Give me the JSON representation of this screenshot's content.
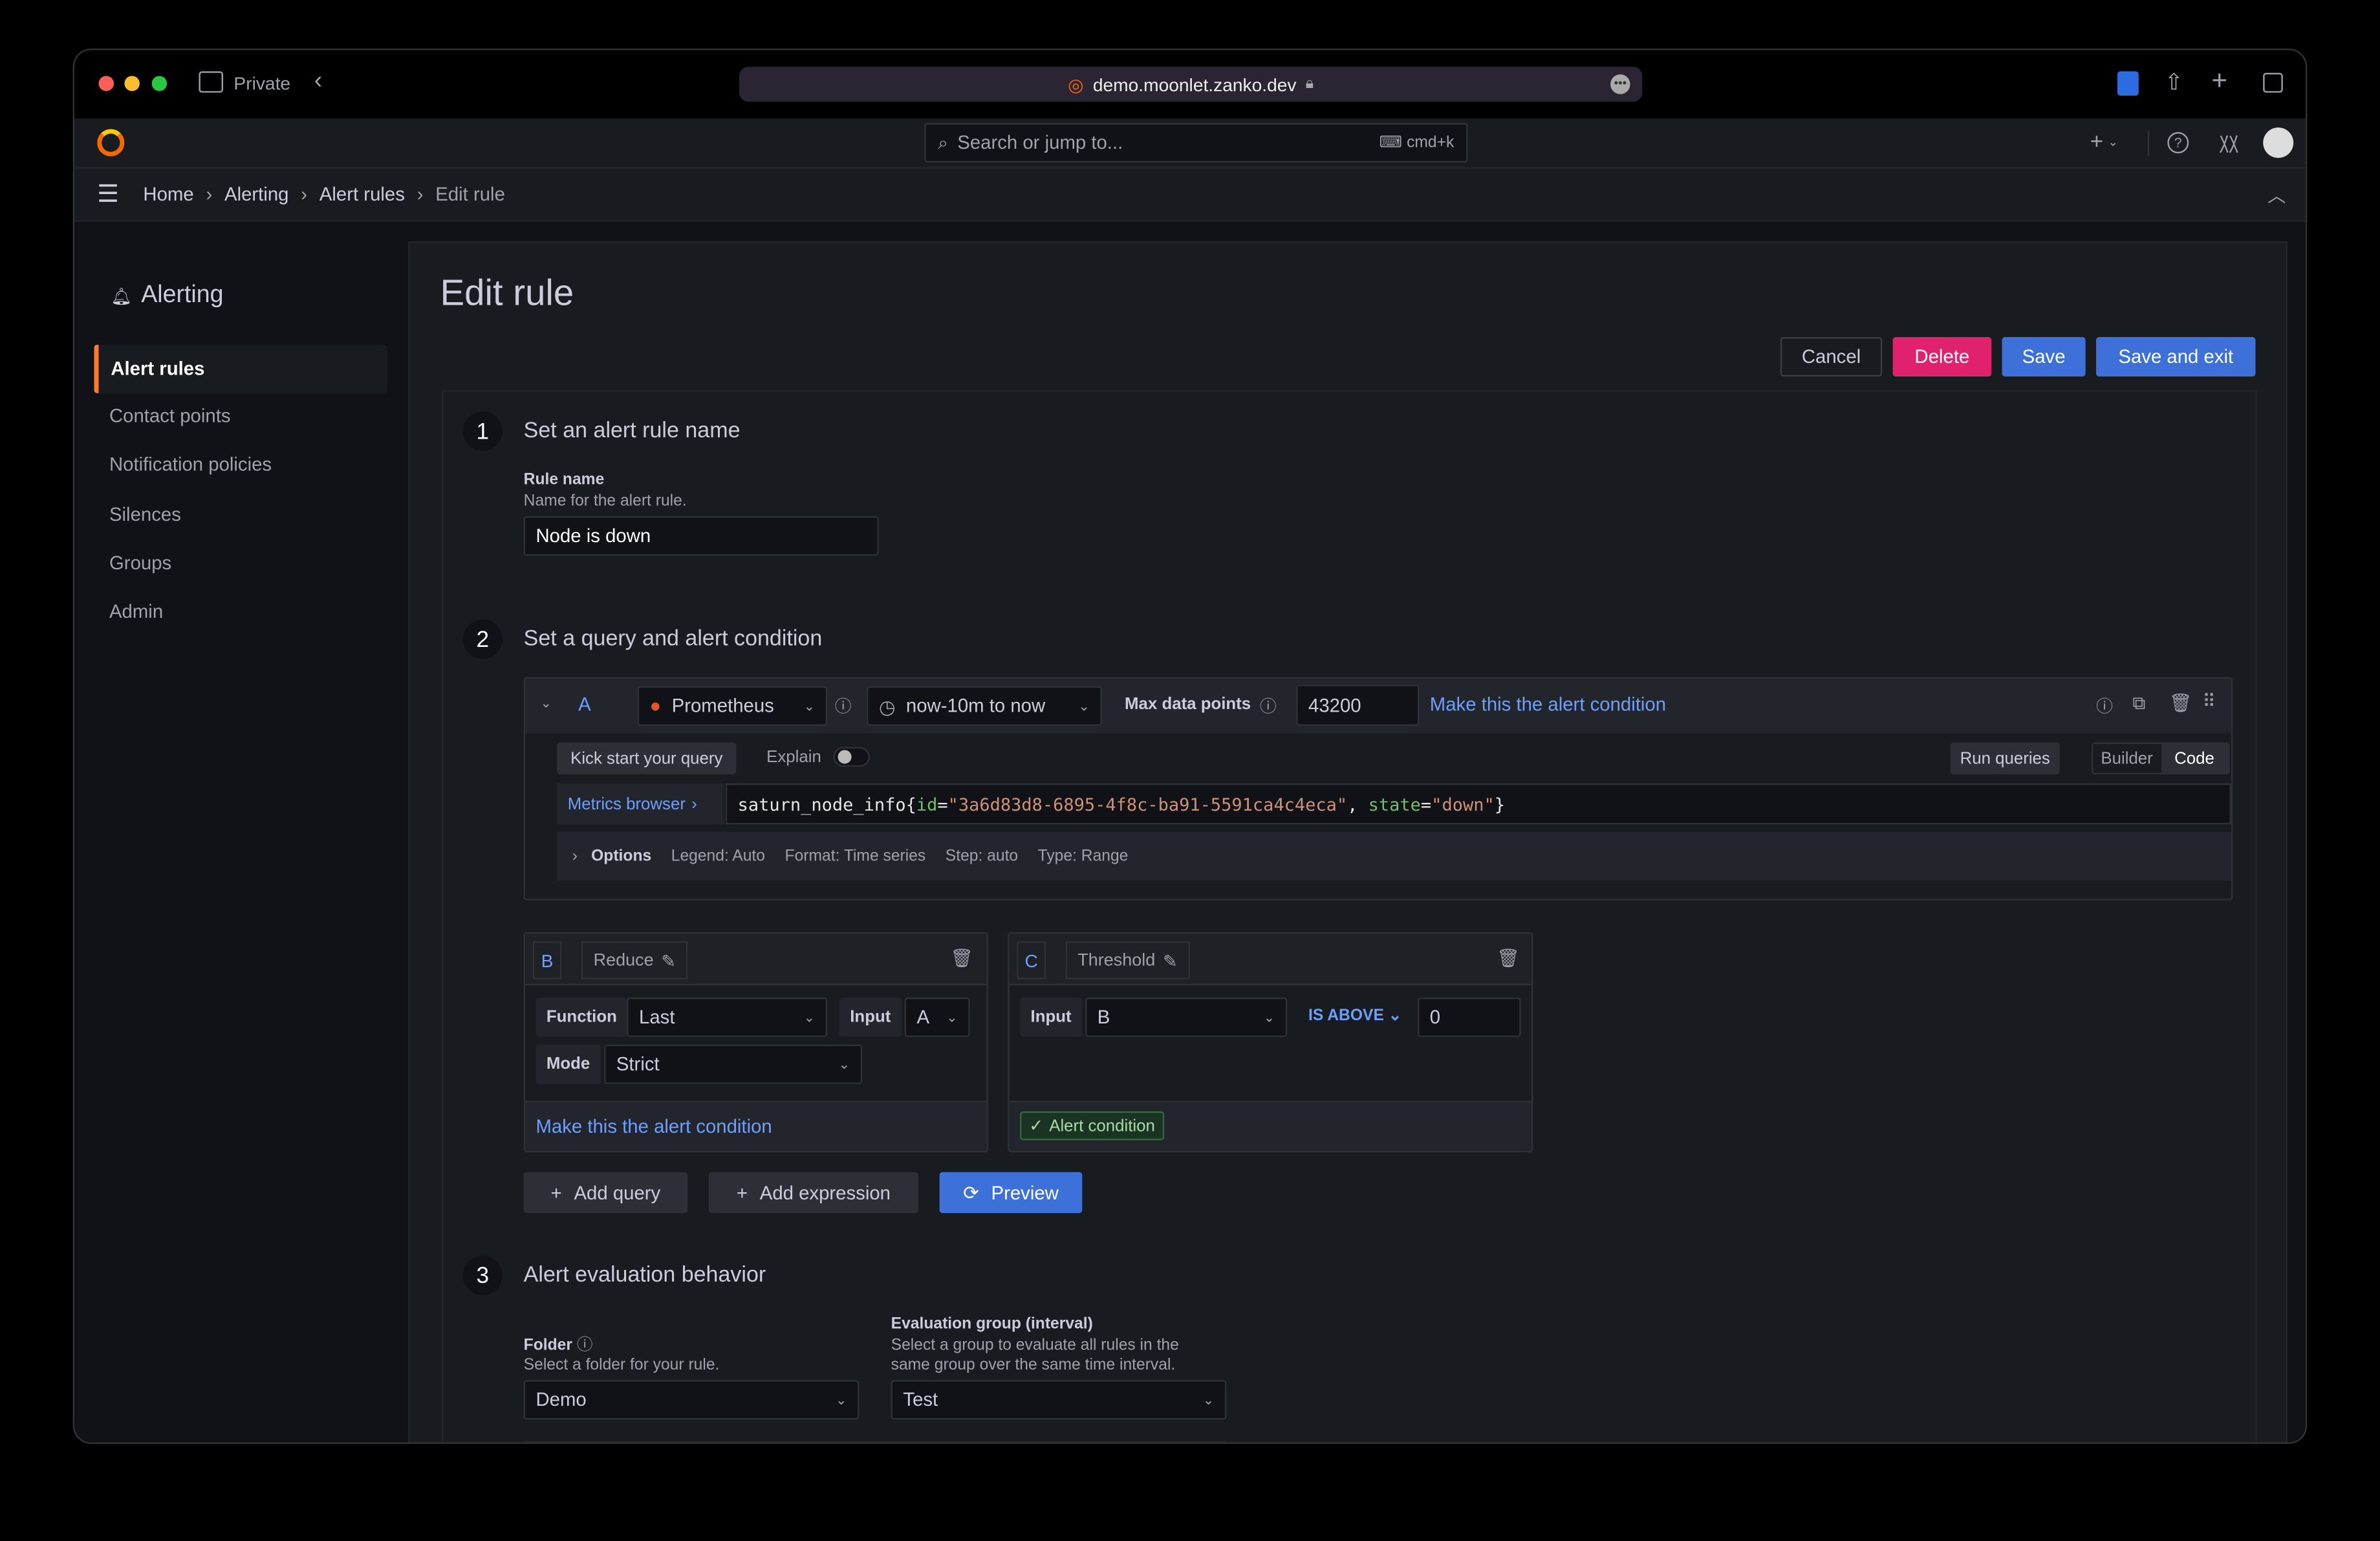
{
  "browser": {
    "private_label": "Private",
    "url": "demo.moonlet.zanko.dev"
  },
  "topbar": {
    "search_placeholder": "Search or jump to...",
    "shortcut": "cmd+k"
  },
  "breadcrumb": [
    "Home",
    "Alerting",
    "Alert rules",
    "Edit rule"
  ],
  "sidebar": {
    "title": "Alerting",
    "items": [
      {
        "label": "Alert rules",
        "active": true
      },
      {
        "label": "Contact points"
      },
      {
        "label": "Notification policies"
      },
      {
        "label": "Silences"
      },
      {
        "label": "Groups"
      },
      {
        "label": "Admin"
      }
    ]
  },
  "page": {
    "title": "Edit rule",
    "cancel": "Cancel",
    "delete": "Delete",
    "save": "Save",
    "save_exit": "Save and exit"
  },
  "colors": {
    "accent": "#3d71d9",
    "danger": "#e0226e",
    "active": "#ff7a2e",
    "success": "#6ccf8e"
  },
  "step1": {
    "num": "1",
    "title": "Set an alert rule name",
    "label": "Rule name",
    "desc": "Name for the alert rule.",
    "value": "Node is down"
  },
  "step2": {
    "num": "2",
    "title": "Set a query and alert condition",
    "queryA": {
      "ref": "A",
      "datasource": "Prometheus",
      "time_range": "now-10m to now",
      "max_label": "Max data points",
      "max_value": "43200",
      "make_cond": "Make this the alert condition",
      "kick": "Kick start your query",
      "explain": "Explain",
      "explain_on": false,
      "run": "Run queries",
      "builder": "Builder",
      "code": "Code",
      "mode": "Code",
      "metrics": "Metrics browser",
      "q_metric": "saturn_node_info{",
      "q_k1": "id",
      "q_eq1": "=",
      "q_v1": "\"3a6d83d8-6895-4f8c-ba91-5591ca4c4eca\"",
      "q_sep": ", ",
      "q_k2": "state",
      "q_eq2": "=",
      "q_v2": "\"down\"",
      "q_end": "}",
      "options": "Options",
      "legend": "Legend: Auto",
      "format": "Format: Time series",
      "step": "Step: auto",
      "type": "Type: Range"
    },
    "exprB": {
      "ref": "B",
      "name": "Reduce",
      "function_label": "Function",
      "function": "Last",
      "input_label": "Input",
      "input": "A",
      "mode_label": "Mode",
      "mode": "Strict",
      "make_cond": "Make this the alert condition"
    },
    "exprC": {
      "ref": "C",
      "name": "Threshold",
      "input_label": "Input",
      "input": "B",
      "op": "IS ABOVE",
      "value": "0",
      "cond": "Alert condition"
    },
    "add_query": "Add query",
    "add_expression": "Add expression",
    "preview": "Preview"
  },
  "step3": {
    "num": "3",
    "title": "Alert evaluation behavior",
    "folder_label": "Folder",
    "folder_desc": "Select a folder for your rule.",
    "folder": "Demo",
    "group_label": "Evaluation group (interval)",
    "group_desc": "Select a group to evaluate all rules in the same group over the same time interval.",
    "group": "Test"
  }
}
